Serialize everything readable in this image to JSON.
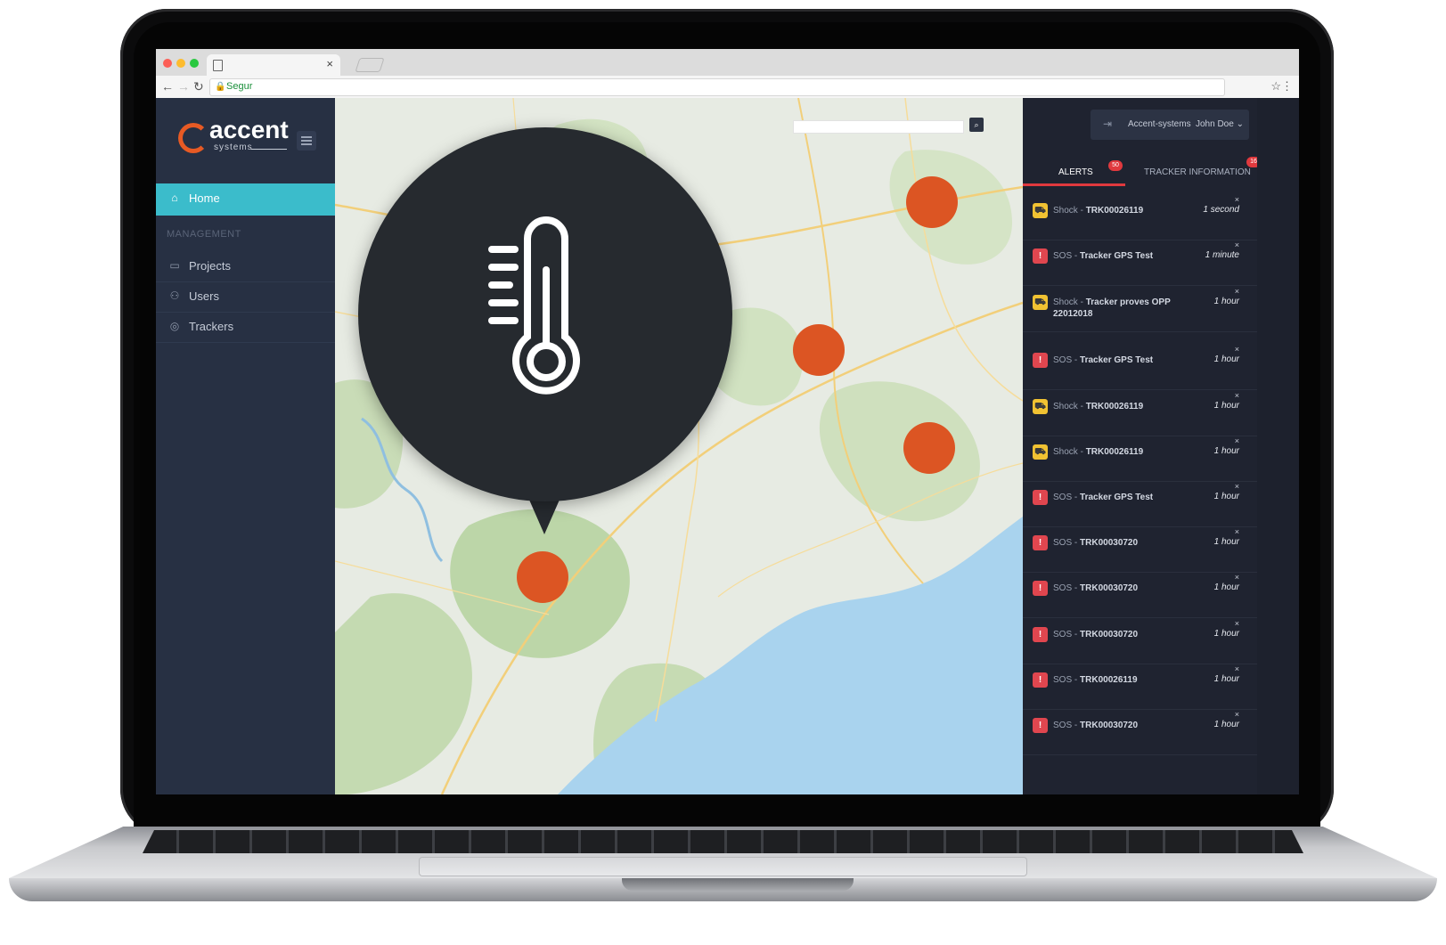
{
  "browser": {
    "url_text": "Segur"
  },
  "sidebar": {
    "logo_word": "accent",
    "logo_sub": "systems",
    "home_label": "Home",
    "section_label": "MANAGEMENT",
    "items": [
      {
        "label": "Projects",
        "icon": "folder-icon"
      },
      {
        "label": "Users",
        "icon": "user-icon"
      },
      {
        "label": "Trackers",
        "icon": "compass-icon"
      }
    ]
  },
  "header": {
    "organization": "Accent-systems",
    "user_name": "John Doe"
  },
  "panel": {
    "tabs": [
      {
        "label": "ALERTS",
        "badge": "50"
      },
      {
        "label": "TRACKER INFORMATION",
        "badge": "16"
      }
    ],
    "alerts": [
      {
        "type": "Shock",
        "device": "TRK00026119",
        "time": "1 second",
        "kind": "shock"
      },
      {
        "type": "SOS",
        "device": "Tracker GPS Test",
        "time": "1 minute",
        "kind": "sos"
      },
      {
        "type": "Shock",
        "device": "Tracker proves OPP 22012018",
        "time": "1 hour",
        "kind": "shock"
      },
      {
        "type": "SOS",
        "device": "Tracker GPS Test",
        "time": "1 hour",
        "kind": "sos"
      },
      {
        "type": "Shock",
        "device": "TRK00026119",
        "time": "1 hour",
        "kind": "shock"
      },
      {
        "type": "Shock",
        "device": "TRK00026119",
        "time": "1 hour",
        "kind": "shock"
      },
      {
        "type": "SOS",
        "device": "Tracker GPS Test",
        "time": "1 hour",
        "kind": "sos"
      },
      {
        "type": "SOS",
        "device": "TRK00030720",
        "time": "1 hour",
        "kind": "sos"
      },
      {
        "type": "SOS",
        "device": "TRK00030720",
        "time": "1 hour",
        "kind": "sos"
      },
      {
        "type": "SOS",
        "device": "TRK00030720",
        "time": "1 hour",
        "kind": "sos"
      },
      {
        "type": "SOS",
        "device": "TRK00026119",
        "time": "1 hour",
        "kind": "sos"
      },
      {
        "type": "SOS",
        "device": "TRK00030720",
        "time": "1 hour",
        "kind": "sos"
      }
    ]
  },
  "colors": {
    "accent": "#3bbccb",
    "marker": "#dc5523",
    "sos": "#e0464f",
    "shock": "#f1c232",
    "brand": "#e75a24"
  },
  "overlay": {
    "icon": "thermometer-icon"
  }
}
